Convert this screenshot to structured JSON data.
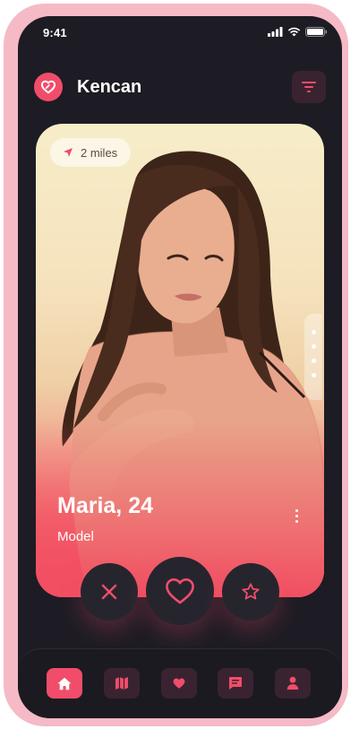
{
  "status_bar": {
    "time": "9:41",
    "icons": [
      "signal-icon",
      "wifi-icon",
      "battery-icon"
    ]
  },
  "header": {
    "title": "Kencan",
    "logo_icon": "heart-logo-icon",
    "filter_icon": "filter-icon"
  },
  "card": {
    "distance": "2 miles",
    "distance_icon": "location-arrow-icon",
    "name_age": "Maria, 24",
    "occupation": "Model",
    "more_icon": "more-vertical-icon",
    "photo_count": 4
  },
  "actions": [
    {
      "name": "pass",
      "icon": "close-icon"
    },
    {
      "name": "like",
      "icon": "heart-outline-icon"
    },
    {
      "name": "super-like",
      "icon": "star-icon"
    }
  ],
  "nav": {
    "items": [
      {
        "id": "home",
        "icon": "home-icon",
        "active": true
      },
      {
        "id": "map",
        "icon": "map-icon",
        "active": false
      },
      {
        "id": "likes",
        "icon": "heart-icon",
        "active": false
      },
      {
        "id": "chat",
        "icon": "chat-icon",
        "active": false
      },
      {
        "id": "profile",
        "icon": "user-icon",
        "active": false
      }
    ]
  },
  "colors": {
    "accent": "#f14d6a",
    "background": "#1d1c24",
    "frame": "#f6b9c6",
    "button_bg": "#3a2330"
  }
}
